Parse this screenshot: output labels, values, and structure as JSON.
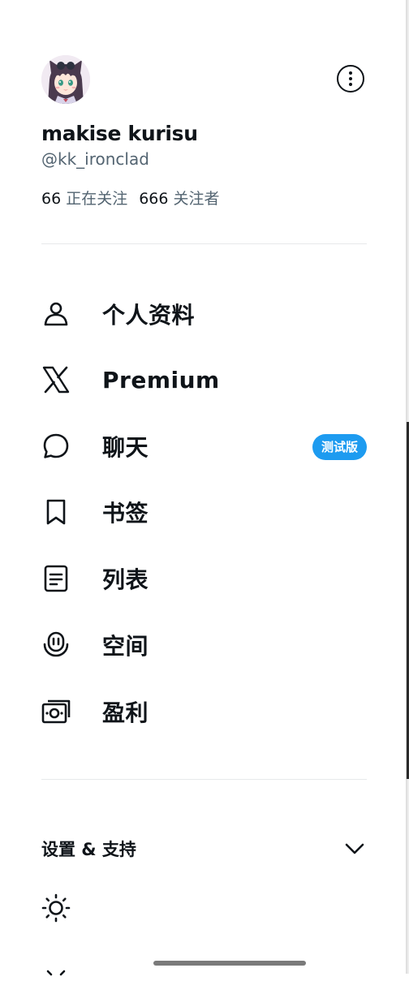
{
  "profile": {
    "display_name": "makise kurisu",
    "handle": "@kk_ironclad",
    "following_count": "66",
    "following_label": "正在关注",
    "followers_count": "666",
    "followers_label": "关注者"
  },
  "icons": {
    "more": "more-circle-icon",
    "profile": "person-icon",
    "premium": "x-logo-icon",
    "chat": "chat-bubble-icon",
    "bookmarks": "bookmark-icon",
    "lists": "list-document-icon",
    "spaces": "microphone-spaces-icon",
    "monetization": "money-icon",
    "settings_chevron": "chevron-down-icon",
    "theme": "sun-icon"
  },
  "menu": {
    "profile": "个人资料",
    "premium": "Premium",
    "chat": "聊天",
    "chat_badge": "测试版",
    "bookmarks": "书签",
    "lists": "列表",
    "spaces": "空间",
    "monetization": "盈利"
  },
  "settings_section": {
    "title": "设置 & 支持"
  },
  "colors": {
    "text": "#0f1419",
    "secondary_text": "#536471",
    "accent": "#1d9bf0",
    "divider": "#e7e9ea"
  }
}
